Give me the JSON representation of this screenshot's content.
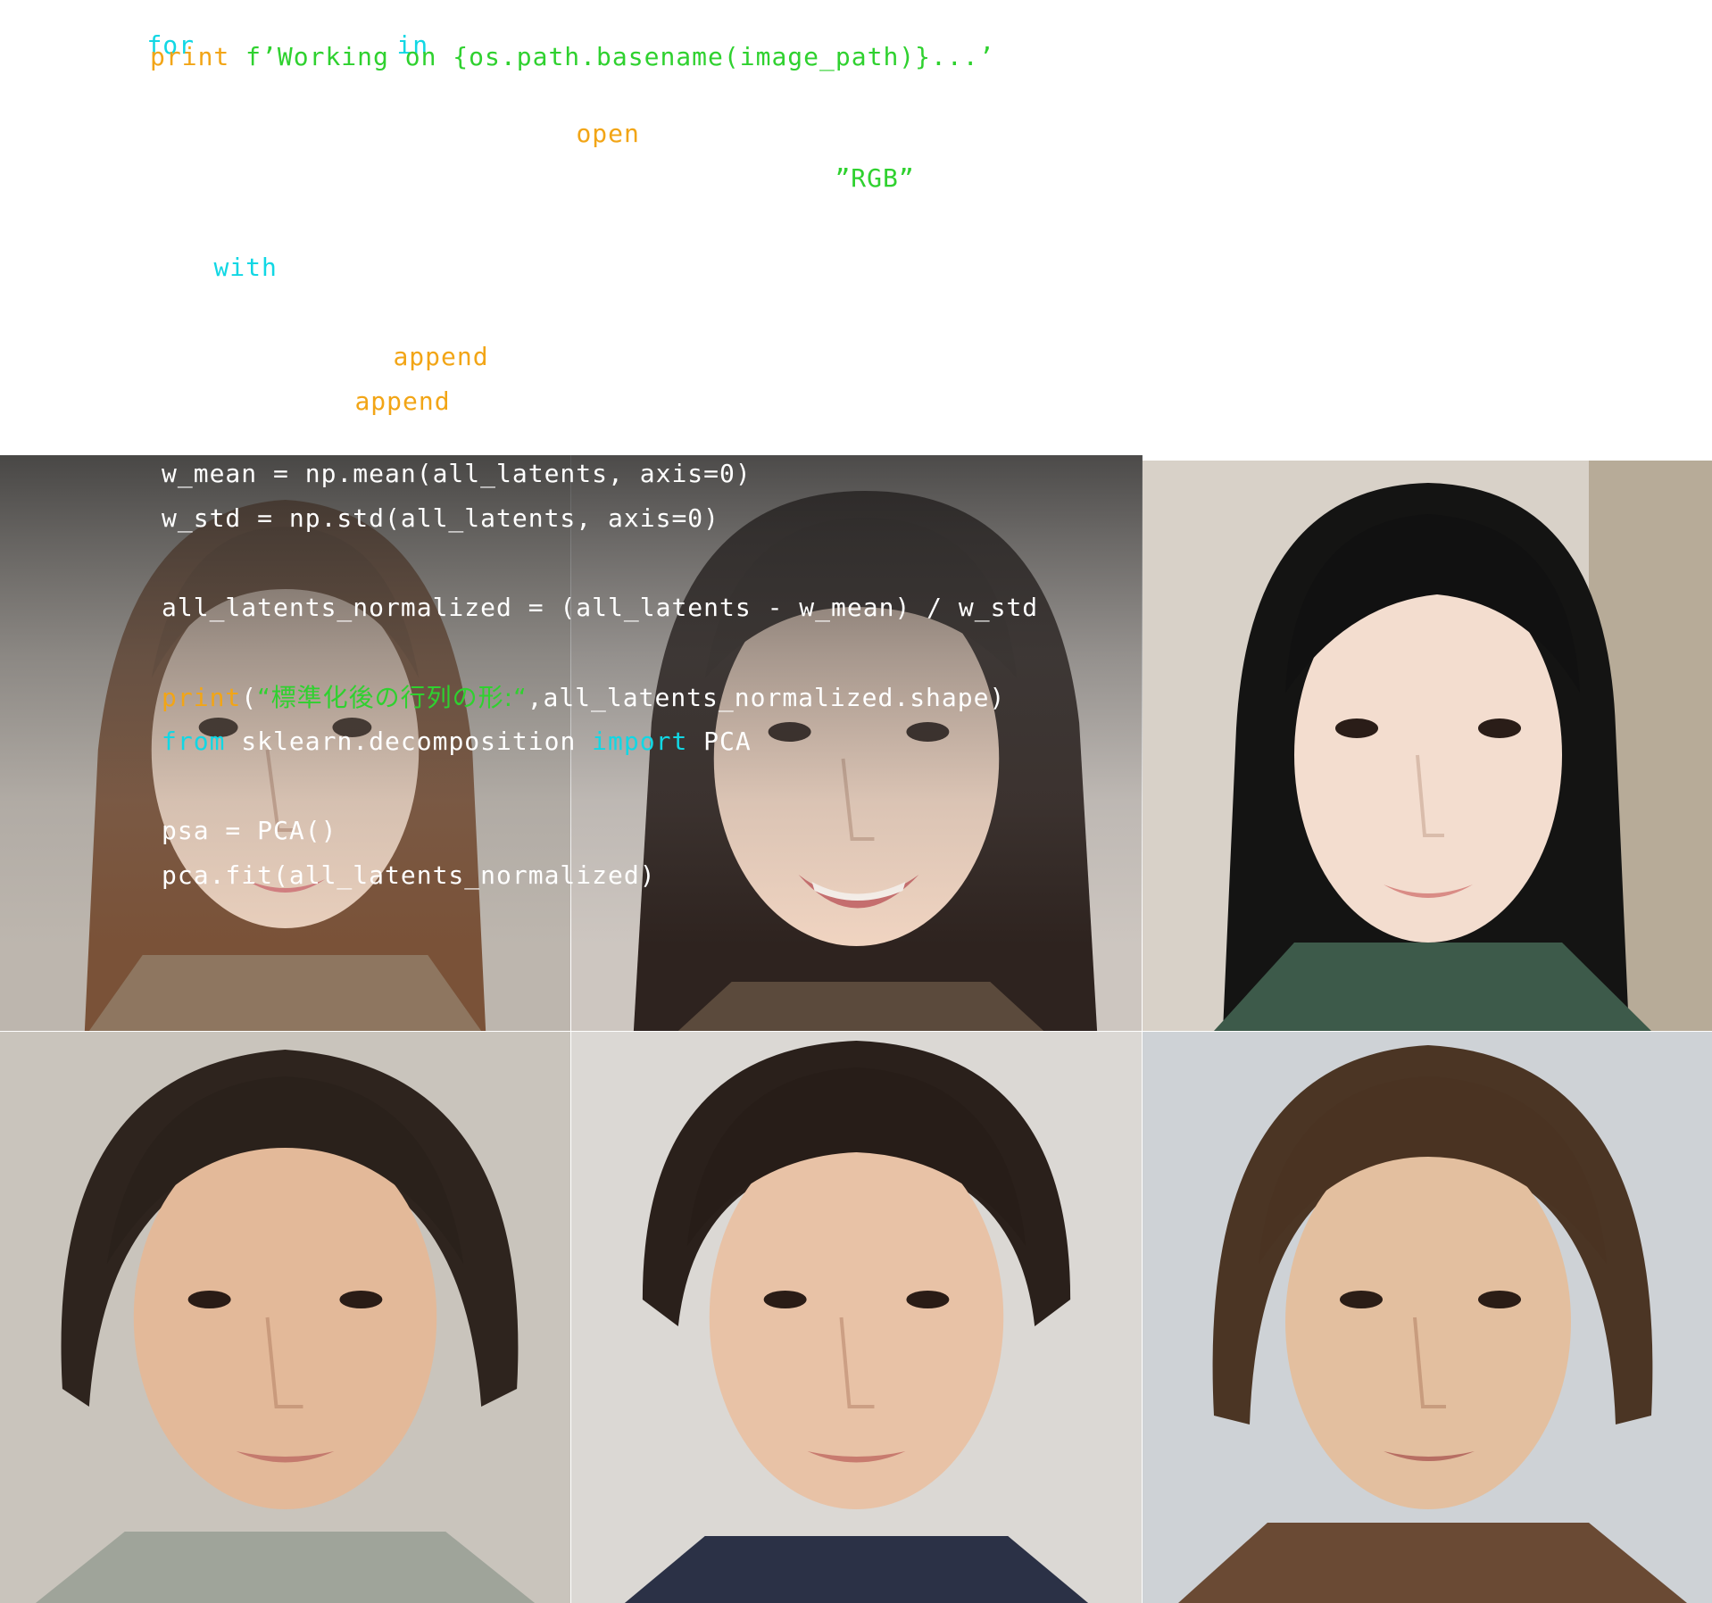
{
  "code": {
    "line1": {
      "for": "for",
      "in": "in"
    },
    "line2": {
      "print": "print",
      "string": "f’Working on {os.path.basename(image_path)}...’"
    },
    "line3": {
      "open": "open"
    },
    "line4": {
      "rgb": "”RGB”"
    },
    "line5": {
      "with": "with"
    },
    "line6": {
      "append": "append"
    },
    "line7": {
      "append": "append"
    },
    "line8": {
      "text": "w_mean = np.mean(all_latents, axis=0)"
    },
    "line9": {
      "text": "w_std = np.std(all_latents, axis=0)"
    },
    "line10": {
      "text": "all_latents_normalized = (all_latents - w_mean) / w_std"
    },
    "line11": {
      "print": "print",
      "paren": "(",
      "string": "“標準化後の行列の形:“",
      "rest": ",all_latents_normalized.shape)"
    },
    "line12": {
      "from": "from",
      "module": " sklearn.decomposition ",
      "import": "import",
      "name": " PCA"
    },
    "line13": {
      "text": "psa = PCA()"
    },
    "line14": {
      "text": "pca.fit(all_latents_normalized)"
    }
  },
  "colors": {
    "keyword_cyan": "#11d7e4",
    "builtin_orange": "#f2a516",
    "string_green": "#2fd12f",
    "plain_white": "#ffffff"
  },
  "faces": [
    {
      "name": "face-1",
      "hair": "#6b4a34",
      "skin": "#e9cdb9",
      "bg": "#b9b2ab"
    },
    {
      "name": "face-2",
      "hair": "#2f2420",
      "skin": "#efd3c0",
      "bg": "#cfc8c2"
    },
    {
      "name": "face-3",
      "hair": "#151514",
      "skin": "#f2dccd",
      "bg": "#d5cfc6"
    },
    {
      "name": "face-4",
      "hair": "#2e241e",
      "skin": "#e2b898",
      "bg": "#c7c2ba"
    },
    {
      "name": "face-5",
      "hair": "#2a201b",
      "skin": "#e6c0a4",
      "bg": "#d9d6d2"
    },
    {
      "name": "face-6",
      "hair": "#4a3422",
      "skin": "#e4c0a0",
      "bg": "#cfd2d6"
    }
  ]
}
